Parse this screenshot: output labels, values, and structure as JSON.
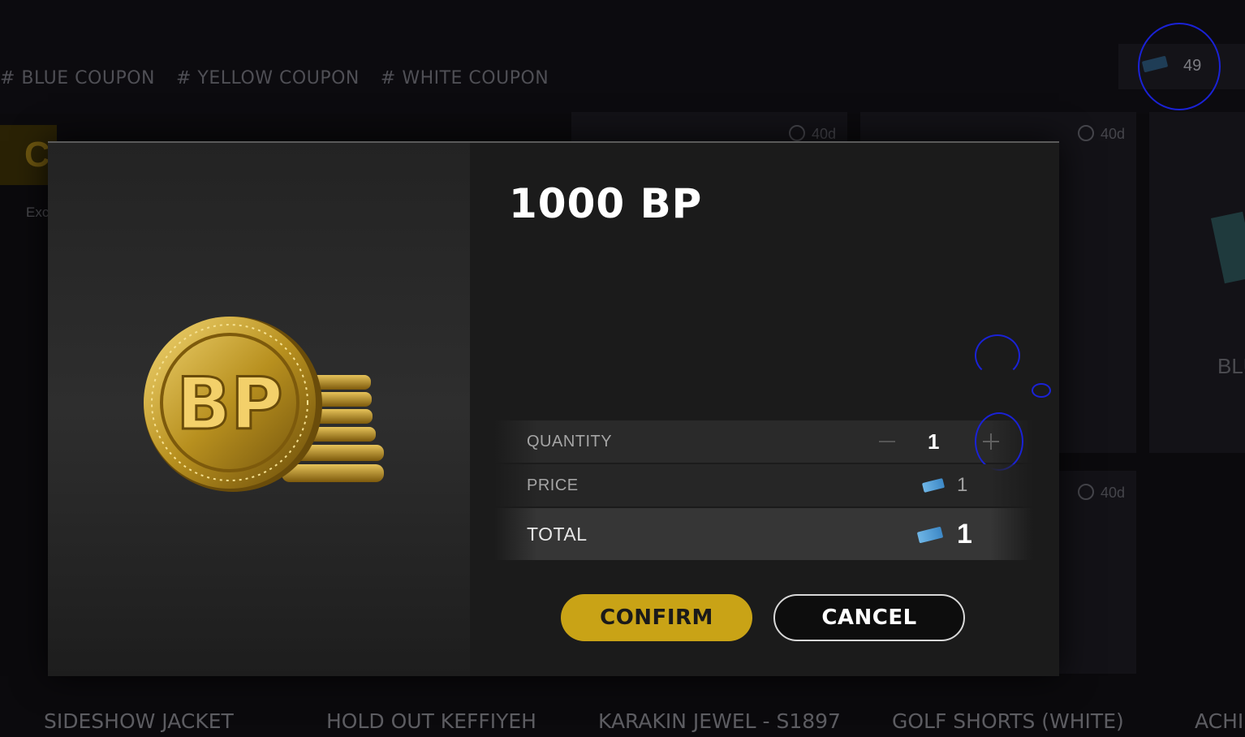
{
  "filters": [
    "# BLUE COUPON",
    "# YELLOW COUPON",
    "# WHITE COUPON"
  ],
  "wallet": {
    "count": "49",
    "icon": "blue-coupon-icon"
  },
  "background_cards": {
    "timers": [
      "40d",
      "40d",
      "40d"
    ],
    "exc_text": "Exc",
    "yellow_letter": "C",
    "side_label": "BLU",
    "bottom_labels": [
      "SIDESHOW JACKET",
      "HOLD OUT KEFFIYEH",
      "KARAKIN JEWEL - S1897",
      "GOLF SHORTS (WHITE)",
      "ACHI"
    ]
  },
  "dialog": {
    "item_name": "1000 BP",
    "item_art": "bp-coin-stack",
    "coin_text": "BP",
    "quantity": {
      "label": "QUANTITY",
      "value": "1"
    },
    "price": {
      "label": "PRICE",
      "value": "1",
      "currency_icon": "blue-coupon-icon"
    },
    "total": {
      "label": "TOTAL",
      "value": "1",
      "currency_icon": "blue-coupon-icon"
    },
    "confirm_label": "CONFIRM",
    "cancel_label": "CANCEL"
  },
  "colors": {
    "accent": "#c9a316",
    "coupon_blue": "#4f9fd8",
    "annotation": "#1a22d6"
  }
}
